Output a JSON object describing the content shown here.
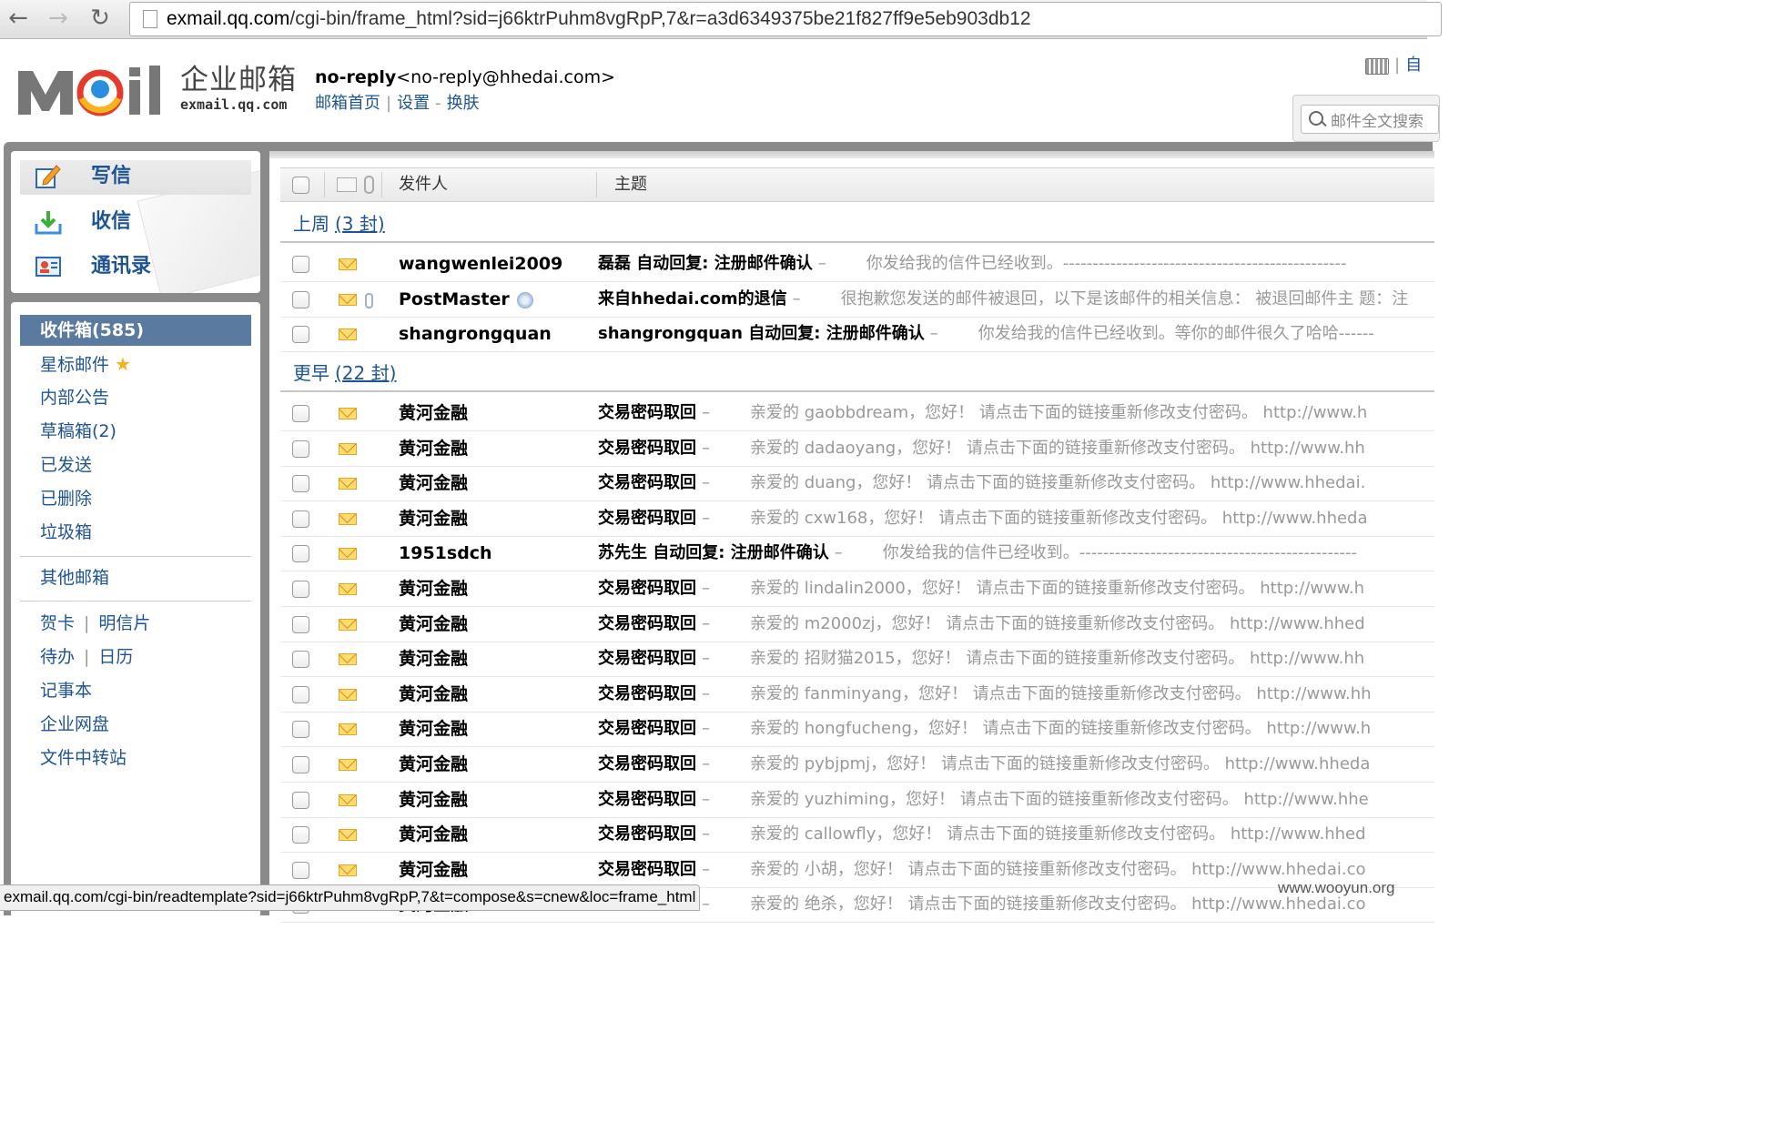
{
  "browser": {
    "back_icon": "back-arrow-icon",
    "forward_icon": "forward-arrow-icon",
    "reload_icon": "reload-icon",
    "url_host": "exmail.qq.com",
    "url_rest": "/cgi-bin/frame_html?sid=j66ktrPuhm8vgRpP,7&r=a3d6349375be21f827ff9e5eb903db12"
  },
  "header": {
    "logo_cn": "企业邮箱",
    "logo_en": "exmail.qq.com",
    "user_name": "no-reply",
    "user_email": "<no-reply@hhedai.com>",
    "link_home": "邮箱首页",
    "link_settings": "设置",
    "link_skin": "换肤",
    "top_right": "自",
    "search_placeholder": "邮件全文搜索"
  },
  "quick_actions": [
    {
      "label": "写信",
      "icon": "compose-icon"
    },
    {
      "label": "收信",
      "icon": "inbox-download-icon"
    },
    {
      "label": "通讯录",
      "icon": "contacts-icon"
    }
  ],
  "folders": {
    "inbox": "收件箱(585)",
    "starred": "星标邮件",
    "announcements": "内部公告",
    "drafts": "草稿箱(2)",
    "sent": "已发送",
    "deleted": "已删除",
    "spam": "垃圾箱",
    "other": "其他邮箱",
    "card": "贺卡",
    "postcard": "明信片",
    "todo": "待办",
    "calendar": "日历",
    "notepad": "记事本",
    "netdisk": "企业网盘",
    "transfer": "文件中转站"
  },
  "list_header": {
    "sender": "发件人",
    "subject": "主题"
  },
  "groups": [
    {
      "title": "上周",
      "count": "(3 封)",
      "rows": [
        {
          "sender": "wangwenlei2009",
          "subject": "磊磊 自动回复: 注册邮件确认",
          "snippet": "你发给我的信件已经收到。------------------------------------------------",
          "attachment": false,
          "qq": false
        },
        {
          "sender": "PostMaster",
          "subject": "来自hhedai.com的退信",
          "snippet": "很抱歉您发送的邮件被退回，以下是该邮件的相关信息：   被退回邮件主 题：注",
          "attachment": true,
          "qq": true
        },
        {
          "sender": "shangrongquan",
          "subject": "shangrongquan 自动回复: 注册邮件确认",
          "snippet": "你发给我的信件已经收到。等你的邮件很久了哈哈------",
          "attachment": false,
          "qq": false
        }
      ]
    },
    {
      "title": "更早",
      "count": "(22 封)",
      "rows": [
        {
          "sender": "黄河金融",
          "subject": "交易密码取回",
          "snippet": "亲爱的 gaobbdream，您好！   请点击下面的链接重新修改支付密码。   http://www.h",
          "attachment": false,
          "qq": false
        },
        {
          "sender": "黄河金融",
          "subject": "交易密码取回",
          "snippet": "亲爱的 dadaoyang，您好！   请点击下面的链接重新修改支付密码。   http://www.hh",
          "attachment": false,
          "qq": false
        },
        {
          "sender": "黄河金融",
          "subject": "交易密码取回",
          "snippet": "亲爱的 duang，您好！   请点击下面的链接重新修改支付密码。   http://www.hhedai.",
          "attachment": false,
          "qq": false
        },
        {
          "sender": "黄河金融",
          "subject": "交易密码取回",
          "snippet": "亲爱的 cxw168，您好！   请点击下面的链接重新修改支付密码。   http://www.hheda",
          "attachment": false,
          "qq": false
        },
        {
          "sender": "1951sdch",
          "subject": "苏先生 自动回复: 注册邮件确认",
          "snippet": "你发给我的信件已经收到。-----------------------------------------------",
          "attachment": false,
          "qq": false
        },
        {
          "sender": "黄河金融",
          "subject": "交易密码取回",
          "snippet": "亲爱的 lindalin2000，您好！   请点击下面的链接重新修改支付密码。   http://www.h",
          "attachment": false,
          "qq": false
        },
        {
          "sender": "黄河金融",
          "subject": "交易密码取回",
          "snippet": "亲爱的 m2000zj，您好！   请点击下面的链接重新修改支付密码。   http://www.hhed",
          "attachment": false,
          "qq": false
        },
        {
          "sender": "黄河金融",
          "subject": "交易密码取回",
          "snippet": "亲爱的 招财猫2015，您好！   请点击下面的链接重新修改支付密码。   http://www.hh",
          "attachment": false,
          "qq": false
        },
        {
          "sender": "黄河金融",
          "subject": "交易密码取回",
          "snippet": "亲爱的 fanminyang，您好！   请点击下面的链接重新修改支付密码。   http://www.hh",
          "attachment": false,
          "qq": false
        },
        {
          "sender": "黄河金融",
          "subject": "交易密码取回",
          "snippet": "亲爱的 hongfucheng，您好！   请点击下面的链接重新修改支付密码。   http://www.h",
          "attachment": false,
          "qq": false
        },
        {
          "sender": "黄河金融",
          "subject": "交易密码取回",
          "snippet": "亲爱的 pybjpmj，您好！   请点击下面的链接重新修改支付密码。   http://www.hheda",
          "attachment": false,
          "qq": false
        },
        {
          "sender": "黄河金融",
          "subject": "交易密码取回",
          "snippet": "亲爱的 yuzhiming，您好！   请点击下面的链接重新修改支付密码。   http://www.hhe",
          "attachment": false,
          "qq": false
        },
        {
          "sender": "黄河金融",
          "subject": "交易密码取回",
          "snippet": "亲爱的 callowfly，您好！   请点击下面的链接重新修改支付密码。   http://www.hhed",
          "attachment": false,
          "qq": false
        },
        {
          "sender": "黄河金融",
          "subject": "交易密码取回",
          "snippet": "亲爱的 小胡，您好！   请点击下面的链接重新修改支付密码。   http://www.hhedai.co",
          "attachment": false,
          "qq": false
        },
        {
          "sender": "黄河金融",
          "subject": "交易密码取回",
          "snippet": "亲爱的 绝杀，您好！   请点击下面的链接重新修改支付密码。   http://www.hhedai.co",
          "attachment": false,
          "qq": false
        }
      ]
    }
  ],
  "status_bar": "exmail.qq.com/cgi-bin/readtemplate?sid=j66ktrPuhm8vgRpP,7&t=compose&s=cnew&loc=frame_html",
  "watermark": "www.wooyun.org",
  "colors": {
    "link": "#1e5494",
    "active_folder": "#5a7aa0",
    "frame": "#8a8a8a",
    "snippet": "#999999"
  }
}
